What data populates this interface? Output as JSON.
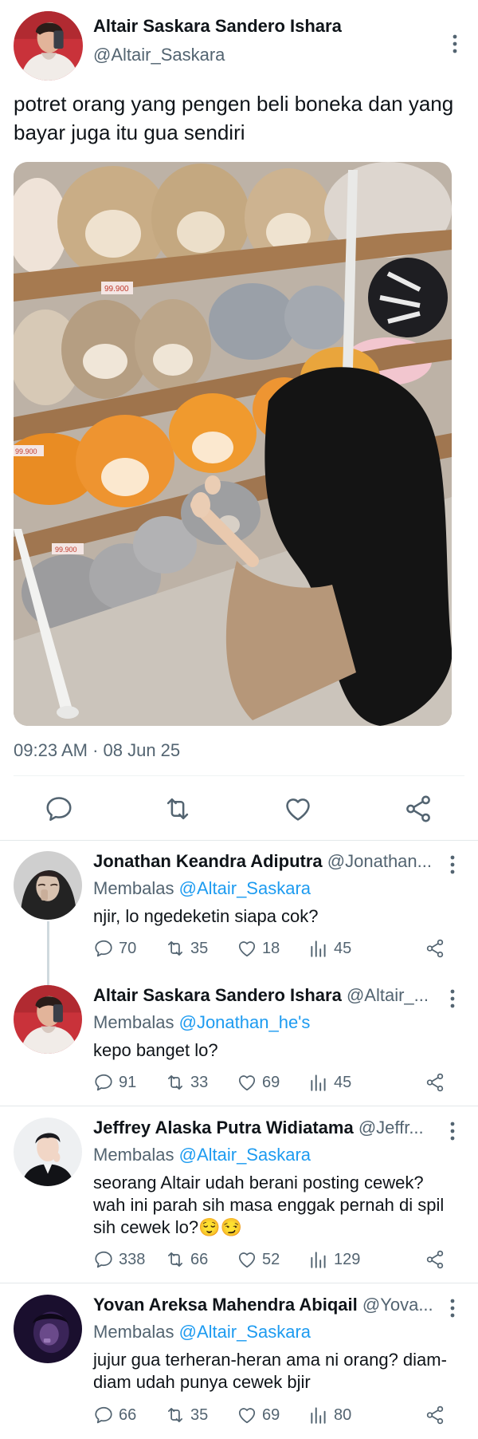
{
  "main_tweet": {
    "name": "Altair Saskara Sandero Ishara",
    "handle": "@Altair_Saskara",
    "text": "potret orang yang pengen beli boneka dan yang bayar juga itu gua sendiri",
    "timestamp": "09:23 AM · 08 Jun 25",
    "photo_price_tags": [
      "99.900",
      "99.900",
      "99.900"
    ],
    "actions": [
      "reply-icon",
      "retweet-icon",
      "like-icon",
      "share-icon"
    ]
  },
  "replies": [
    {
      "name": "Jonathan Keandra Adiputra",
      "handle": "@Jonathan...",
      "replying_label": "Membalas",
      "replying_to": "@Altair_Saskara",
      "text": "njir, lo ngedeketin siapa cok?",
      "stats": {
        "replies": "70",
        "retweets": "35",
        "likes": "18",
        "views": "45"
      }
    },
    {
      "name": "Altair Saskara Sandero Ishara",
      "handle": "@Altair_...",
      "replying_label": "Membalas",
      "replying_to": "@Jonathan_he's",
      "text": "kepo banget lo?",
      "stats": {
        "replies": "91",
        "retweets": "33",
        "likes": "69",
        "views": "45"
      }
    },
    {
      "name": "Jeffrey Alaska Putra Widiatama",
      "handle": "@Jeffr...",
      "replying_label": "Membalas",
      "replying_to": "@Altair_Saskara",
      "text": "seorang Altair udah berani posting cewek? wah ini parah sih masa enggak pernah di spil sih cewek lo?😌😏",
      "stats": {
        "replies": "338",
        "retweets": "66",
        "likes": "52",
        "views": "129"
      }
    },
    {
      "name": "Yovan Areksa Mahendra Abiqail",
      "handle": "@Yova...",
      "replying_label": "Membalas",
      "replying_to": "@Altair_Saskara",
      "text": "jujur gua terheran-heran ama ni orang? diam-diam udah punya cewek bjir",
      "stats": {
        "replies": "66",
        "retweets": "35",
        "likes": "69",
        "views": "80"
      }
    }
  ],
  "colors": {
    "text": "#0f1419",
    "secondary": "#536471",
    "mention": "#1d9bf0",
    "divider": "#eff3f4"
  }
}
